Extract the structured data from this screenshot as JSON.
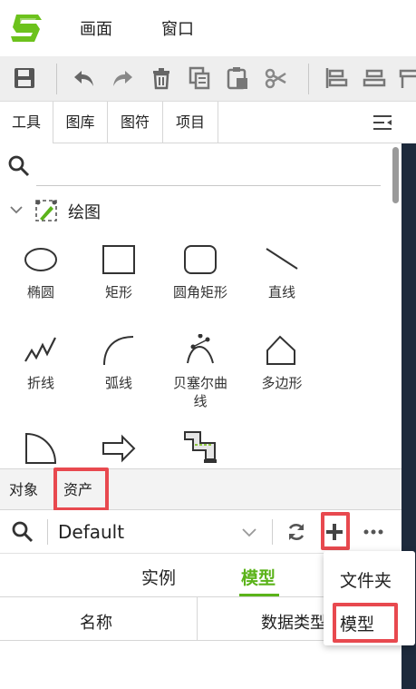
{
  "menubar": {
    "logo_icon": "app-logo-s",
    "items": [
      "画面",
      "窗口"
    ]
  },
  "toolbar": {
    "icons": [
      "save-icon",
      "undo-icon",
      "redo-icon",
      "delete-icon",
      "copy-icon",
      "paste-icon",
      "cut-icon",
      "align-left-icon",
      "align-center-icon",
      "align-right-icon"
    ]
  },
  "tabs": {
    "items": [
      "工具",
      "图库",
      "图符",
      "项目"
    ],
    "active": "工具",
    "menu_icon": "panel-menu-icon"
  },
  "search": {
    "icon": "search-icon",
    "placeholder": ""
  },
  "section": {
    "title": "绘图"
  },
  "shapes": [
    {
      "label": "椭圆",
      "icon": "ellipse-icon"
    },
    {
      "label": "矩形",
      "icon": "rectangle-icon"
    },
    {
      "label": "圆角矩形",
      "icon": "rounded-rectangle-icon"
    },
    {
      "label": "直线",
      "icon": "line-icon"
    },
    {
      "label": "折线",
      "icon": "polyline-icon"
    },
    {
      "label": "弧线",
      "icon": "arc-icon"
    },
    {
      "label": "贝塞尔曲线",
      "icon": "bezier-icon"
    },
    {
      "label": "多边形",
      "icon": "polygon-icon"
    },
    {
      "label": "",
      "icon": "quarter-circle-icon"
    },
    {
      "label": "",
      "icon": "arrow-shape-icon"
    },
    {
      "label": "",
      "icon": "pipe-icon"
    }
  ],
  "bottom_tabs": {
    "items": [
      "对象",
      "资产"
    ],
    "active": "资产"
  },
  "asset_bar": {
    "select_value": "Default",
    "icons": [
      "search-icon",
      "chevron-down-icon",
      "refresh-icon",
      "add-icon",
      "more-icon"
    ]
  },
  "subtabs": {
    "items": [
      "实例",
      "模型"
    ],
    "active": "模型",
    "accent": "#5bb31a"
  },
  "table": {
    "columns": [
      "名称",
      "数据类型"
    ]
  },
  "popup": {
    "items": [
      "文件夹",
      "模型"
    ]
  },
  "colors": {
    "highlight": "#e8494f",
    "accent_green": "#5bb31a",
    "canvas": "#1d2a3c"
  }
}
